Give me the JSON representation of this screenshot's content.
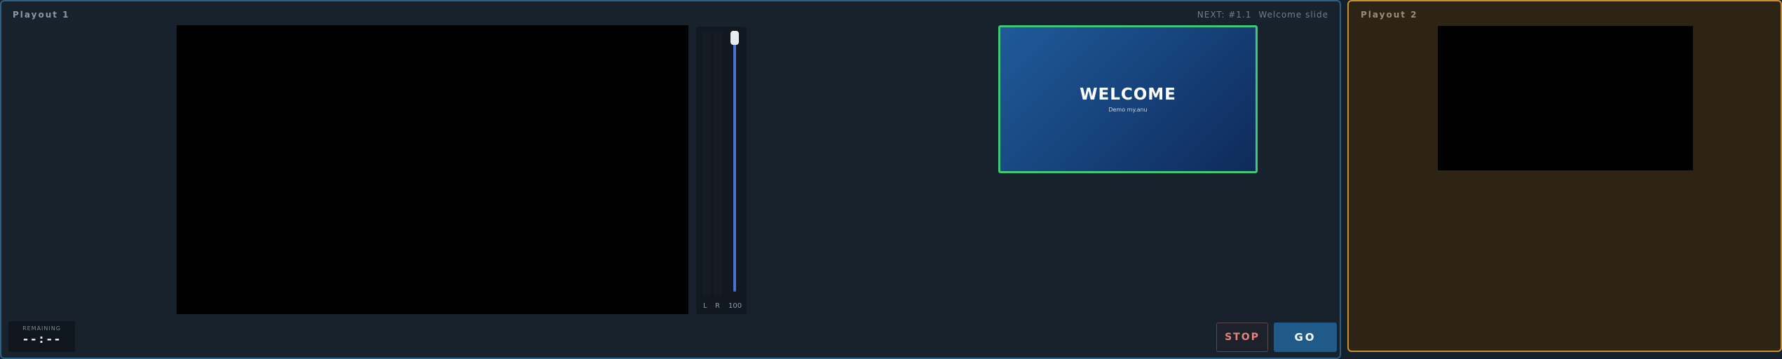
{
  "playout1": {
    "title": "Playout 1",
    "next": {
      "label": "NEXT:",
      "cue": "#1.1",
      "name": "Welcome slide"
    },
    "meter": {
      "left_label": "L",
      "right_label": "R",
      "level": "100",
      "fader_level": 1.0
    },
    "preview": {
      "title": "WELCOME",
      "subtitle": "Demo my.anu"
    },
    "remaining": {
      "label": "REMAINING",
      "value": "--:--"
    },
    "buttons": {
      "stop": "STOP",
      "go": "GO"
    }
  },
  "playout2": {
    "title": "Playout 2"
  },
  "colors": {
    "preview_border": "#40c879",
    "go_button": "#1f5a89",
    "stop_text": "#e5827e",
    "panel2_border": "#c9922e",
    "panel1_border": "#2b5f86",
    "fader": "#4a6fd6"
  }
}
